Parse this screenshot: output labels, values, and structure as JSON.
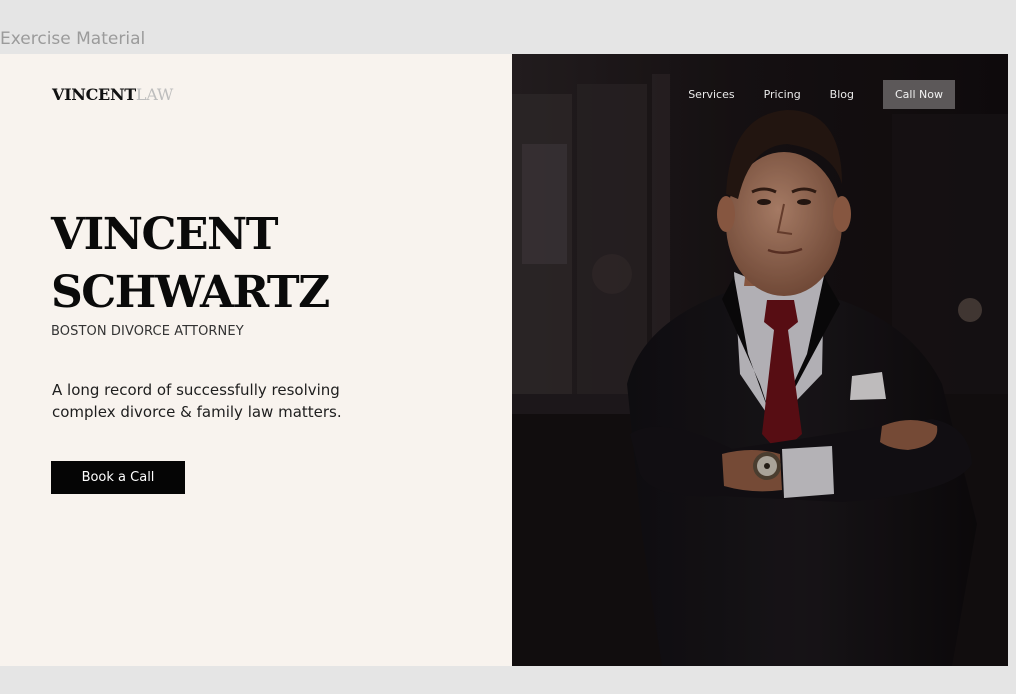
{
  "frame": {
    "label": "Exercise Material"
  },
  "logo": {
    "part_bold": "VINCENT",
    "part_light": "LAW"
  },
  "hero": {
    "name_line1": "VINCENT",
    "name_line2": "SCHWARTZ",
    "subtitle": "BOSTON DIVORCE ATTORNEY",
    "description": "A long record of successfully resolving complex divorce & family law matters.",
    "cta_label": "Book a Call"
  },
  "nav": {
    "items": [
      {
        "label": "Services"
      },
      {
        "label": "Pricing"
      },
      {
        "label": "Blog"
      }
    ],
    "button_label": "Call Now"
  },
  "colors": {
    "left_background": "#f8f3ee",
    "cta_background": "#050505",
    "nav_button_background": "#5c5859",
    "photo_background": "#0f0a0b",
    "tie": "#6b1018"
  },
  "image": {
    "subject": "attorney-portrait-photo"
  }
}
